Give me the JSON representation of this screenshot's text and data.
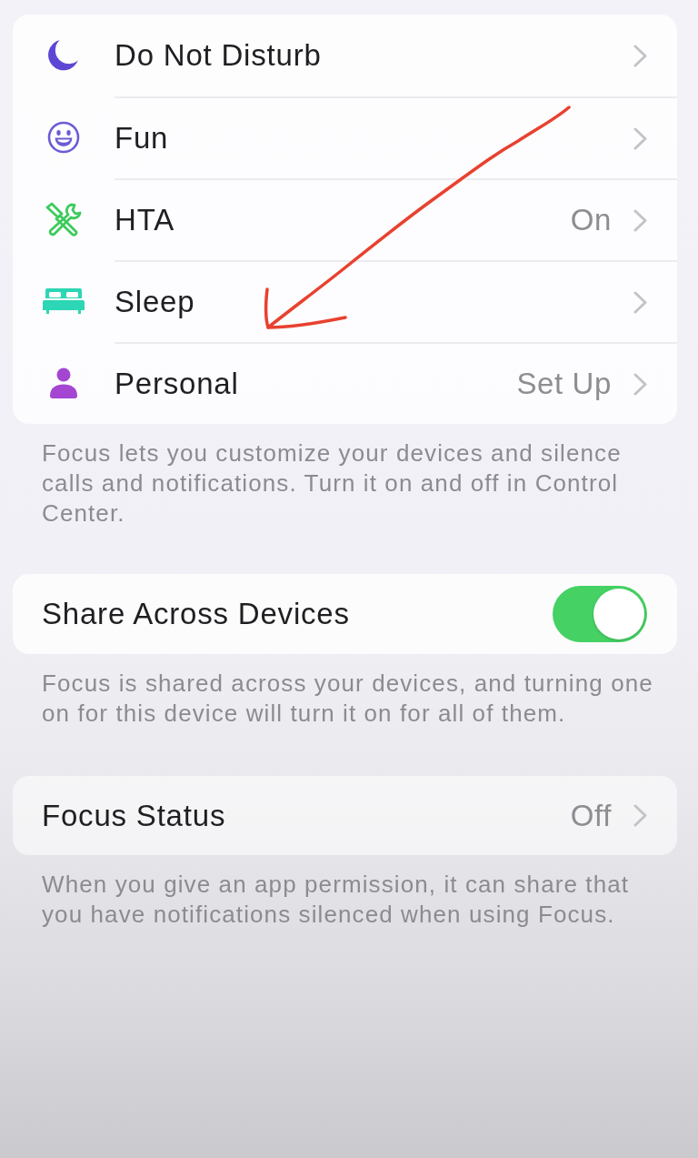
{
  "focus_modes": [
    {
      "label": "Do Not Disturb",
      "color": "#5b47d4"
    },
    {
      "label": "Fun",
      "color": "#6a5bd6"
    },
    {
      "label": "HTA",
      "value": "On",
      "color": "#3ccb5c"
    },
    {
      "label": "Sleep",
      "color": "#2dd6b4"
    },
    {
      "label": "Personal",
      "value": "Set Up",
      "color": "#a446d2"
    }
  ],
  "focus_modes_footer": "Focus lets you customize your devices and silence calls and notifications. Turn it on and off in Control Center.",
  "share_across_devices": {
    "label": "Share Across Devices",
    "on": true,
    "footer": "Focus is shared across your devices, and turning one on for this device will turn it on for all of them."
  },
  "focus_status": {
    "label": "Focus Status",
    "value": "Off",
    "footer": "When you give an app permission, it can share that you have notifications silenced when using Focus."
  },
  "annotations": [
    {
      "kind": "arrow"
    }
  ]
}
